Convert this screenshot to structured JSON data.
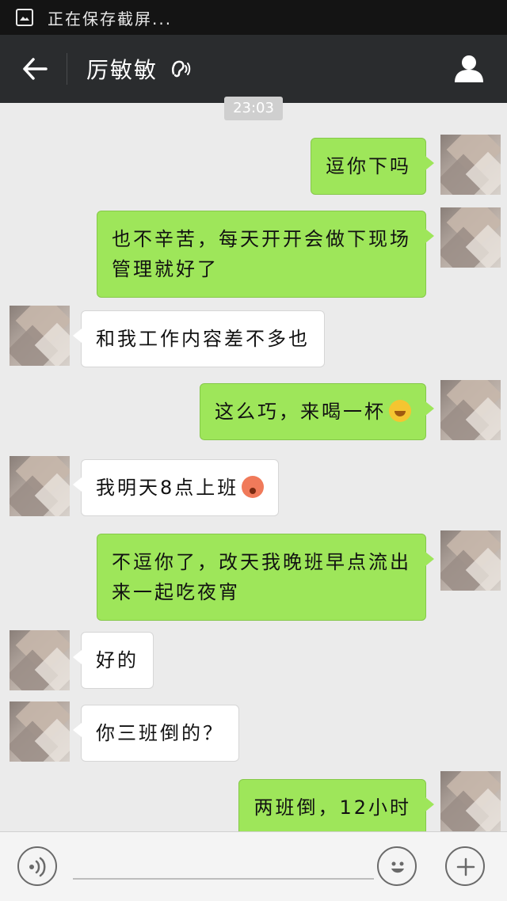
{
  "status_bar": {
    "text": "正在保存截屏...",
    "icon": "image-icon"
  },
  "header": {
    "title": "厉敏敏",
    "icons": [
      "back-arrow-icon",
      "earpiece-mode-icon",
      "contact-profile-icon"
    ]
  },
  "time_label": "23:03",
  "messages": [
    {
      "side": "sent",
      "text": "逗你下吗"
    },
    {
      "side": "sent",
      "text": "也不辛苦，每天开开会做下现场管理就好了"
    },
    {
      "side": "received",
      "text": "和我工作内容差不多也"
    },
    {
      "side": "sent",
      "text": "这么巧，来喝一杯",
      "emoji": "grinning-emoji-icon"
    },
    {
      "side": "received",
      "text": "我明天8点上班",
      "emoji": "flushed-emoji-icon"
    },
    {
      "side": "sent",
      "text": "不逗你了，改天我晚班早点流出来一起吃夜宵"
    },
    {
      "side": "received",
      "text": "好的"
    },
    {
      "side": "received",
      "text": "你三班倒的？"
    },
    {
      "side": "sent",
      "text": "两班倒，12小时"
    }
  ],
  "input_bar": {
    "icons": [
      "voice-icon",
      "emoji-icon",
      "plus-icon"
    ]
  },
  "colors": {
    "sent_bubble": "#9ee65a",
    "received_bubble": "#ffffff",
    "chat_background": "#ebebeb",
    "title_bar": "#2a2c2e",
    "status_bar": "#141414"
  }
}
